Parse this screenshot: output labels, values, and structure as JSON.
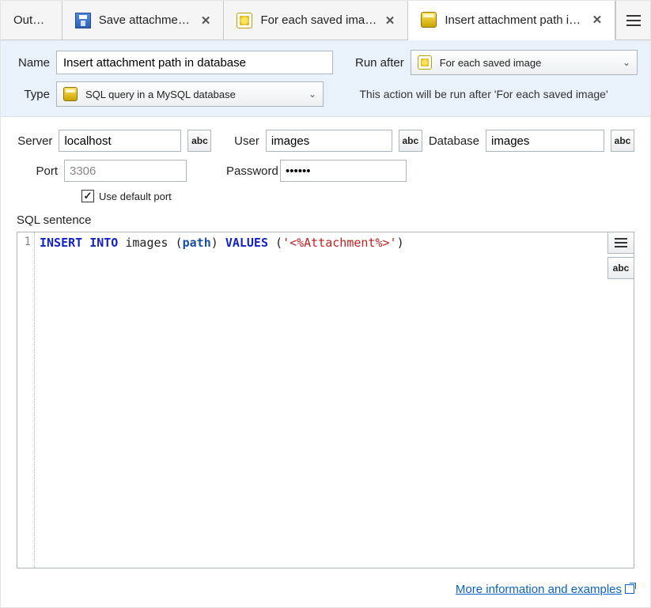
{
  "tabs": {
    "output": "Output",
    "save_attachments": "Save attachments",
    "foreach": "For each saved image",
    "insert": "Insert attachment path in d"
  },
  "header": {
    "name_label": "Name",
    "name_value": "Insert attachment path in database",
    "type_label": "Type",
    "type_value": "SQL query in a MySQL database",
    "run_after_label": "Run after",
    "run_after_value": "For each saved image",
    "hint": "This action will be run after 'For each saved image'"
  },
  "params": {
    "server_label": "Server",
    "server_value": "localhost",
    "user_label": "User",
    "user_value": "images",
    "database_label": "Database",
    "database_value": "images",
    "port_label": "Port",
    "port_value": "3306",
    "password_label": "Password",
    "password_value": "••••••",
    "use_default_port_label": "Use default port",
    "abc_label": "abc"
  },
  "sql": {
    "title": "SQL sentence",
    "line_no": "1",
    "kw_insert": "INSERT INTO",
    "tbl": " images ",
    "paren_open": "(",
    "col": "path",
    "paren_close_sp": ") ",
    "kw_values": "VALUES",
    "sp_paren": " (",
    "str": "'<%Attachment%>'",
    "end": ")"
  },
  "footer": {
    "link": "More information and examples"
  }
}
